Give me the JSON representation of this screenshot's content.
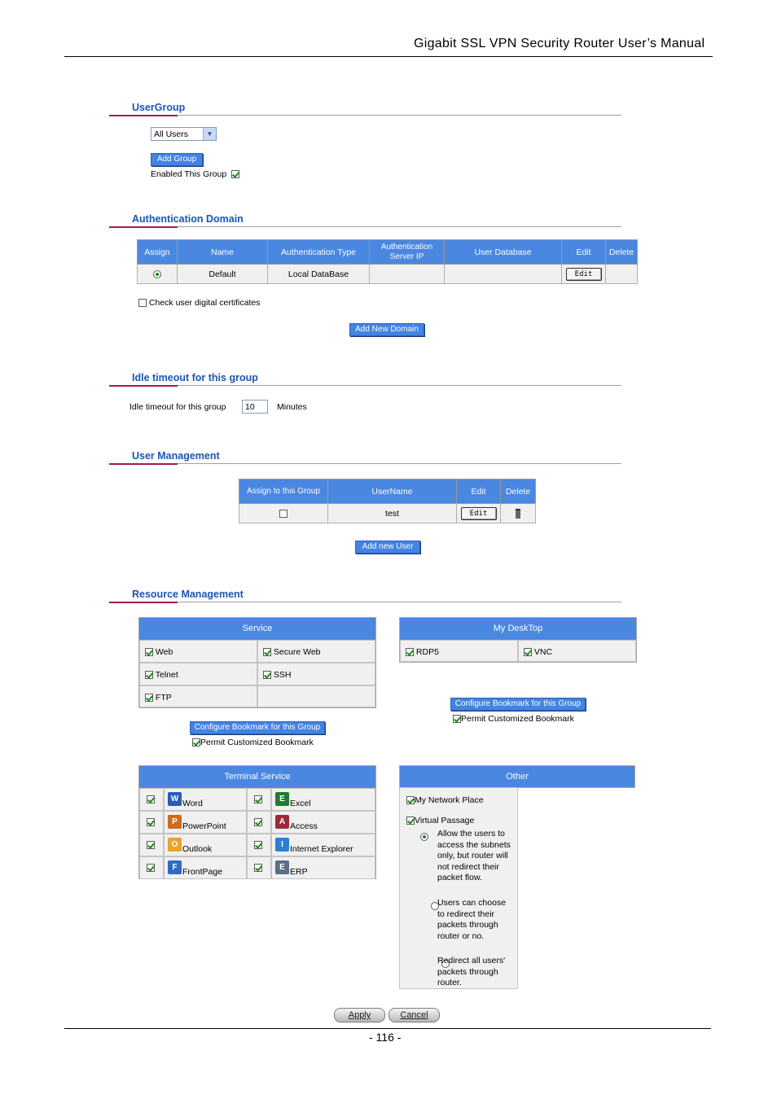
{
  "doc": {
    "header": "Gigabit  SSL  VPN  Security  Router  User’s  Manual",
    "page_number": "- 116 -"
  },
  "usergroup": {
    "title": "UserGroup",
    "select_value": "All Users",
    "add_group": "Add Group",
    "enabled_label": "Enabled This Group",
    "enabled_checked": true
  },
  "auth": {
    "title": "Authentication Domain",
    "columns": [
      "Assign",
      "Name",
      "Authentication Type",
      "Authentication Server IP",
      "User Database",
      "Edit",
      "Delete"
    ],
    "row": {
      "name": "Default",
      "type": "Local DataBase",
      "server_ip": "",
      "user_db": "",
      "edit": "Edit",
      "assigned": true
    },
    "check_cert_label": "Check user digital certificates",
    "add_domain": "Add New Domain"
  },
  "idle": {
    "title": "Idle timeout for this group",
    "label": "Idle timeout for this group",
    "value": "10",
    "unit": "Minutes"
  },
  "users": {
    "title": "User Management",
    "columns": [
      "Assign to this Group",
      "UserName",
      "Edit",
      "Delete"
    ],
    "row": {
      "username": "test",
      "edit": "Edit"
    },
    "add_user": "Add new User"
  },
  "resources": {
    "title": "Resource Management",
    "service": {
      "head": "Service",
      "items": [
        {
          "label": "Web",
          "checked": true
        },
        {
          "label": "Secure Web",
          "checked": true
        },
        {
          "label": "Telnet",
          "checked": true
        },
        {
          "label": "SSH",
          "checked": true
        },
        {
          "label": "FTP",
          "checked": true
        }
      ],
      "configure": "Configure Bookmark for this Group",
      "permit": "Permit Customized Bookmark"
    },
    "desktop": {
      "head": "My DeskTop",
      "items": [
        {
          "label": "RDP5",
          "checked": true
        },
        {
          "label": "VNC",
          "checked": true
        }
      ],
      "configure": "Configure Bookmark for this Group",
      "permit": "Permit Customized Bookmark"
    },
    "terminal": {
      "head": "Terminal Service",
      "items": [
        {
          "label": "Word",
          "icon": "word-icon",
          "color": "#2a5bb8"
        },
        {
          "label": "Excel",
          "icon": "excel-icon",
          "color": "#1d7a35"
        },
        {
          "label": "PowerPoint",
          "icon": "powerpoint-icon",
          "color": "#d06a1e"
        },
        {
          "label": "Access",
          "icon": "access-icon",
          "color": "#9a2b3b"
        },
        {
          "label": "Outlook",
          "icon": "outlook-icon",
          "color": "#e8a32a"
        },
        {
          "label": "Internet Explorer",
          "icon": "internet-explorer-icon",
          "color": "#2b7fd4"
        },
        {
          "label": "FrontPage",
          "icon": "frontpage-icon",
          "color": "#2f6bc4"
        },
        {
          "label": "ERP",
          "icon": "erp-icon",
          "color": "#5a6e86"
        }
      ]
    },
    "other": {
      "head": "Other",
      "my_network": "My Network Place",
      "virtual_passage": "Virtual Passage",
      "options": [
        "Allow the users to access the subnets only, but router will not redirect their packet flow.",
        "Users can choose to redirect their packets through router or no.",
        "Redirect all users' packets through router."
      ]
    }
  },
  "footer": {
    "apply": "Apply",
    "cancel": "Cancel"
  }
}
